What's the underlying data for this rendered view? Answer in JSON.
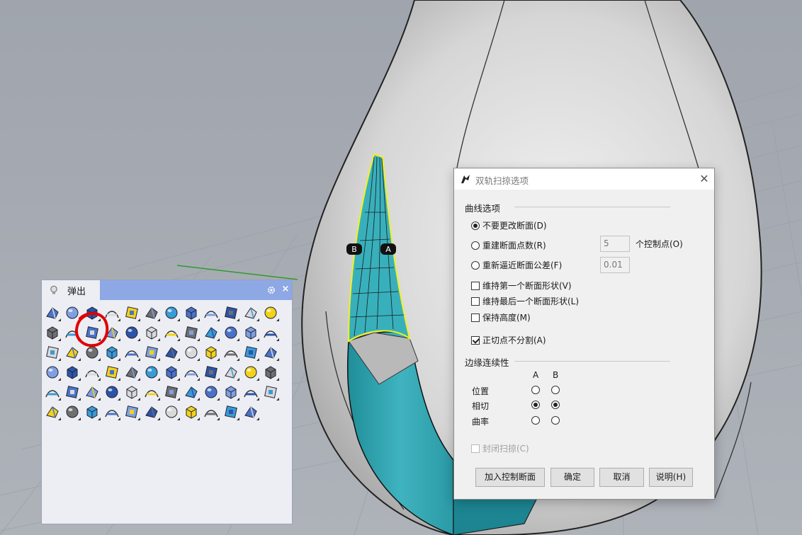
{
  "viewport": {
    "label_b": "B",
    "label_a": "A"
  },
  "popup": {
    "tab_label": "弹出",
    "close_glyph": "×",
    "tools": [
      "render-sphere",
      "curve-wave",
      "circle-arc",
      "curve-degree-2",
      "curve-arc-point",
      "line-dotted-degree",
      "circle-degree",
      "color-wheel",
      "box-shaded",
      "cone-yellow",
      "cube-yellow",
      "cloud-surface",
      "box-blue",
      "loft-box",
      "sweep-2-rail",
      "edge-surface",
      "surface-funnel",
      "fan-surface",
      "sweep-1-rail",
      "network-surface",
      "patch-surface",
      "extrude-cube",
      "twisted-surface",
      "planar-surface",
      "sphere-highlight",
      "bend-surface",
      "curve-degree-points",
      "trim-person",
      "bounding-box",
      "plane-normal",
      "offset-surface",
      "stair-surface",
      "blend-curl",
      "boolean-union",
      "boolean-difference",
      "boolean-split",
      "spheres-pair",
      "cube-solid",
      "box-solid",
      "lines-surface",
      "flat-panel",
      "sheet-fold",
      "numbered-sheet",
      "gear-puzzle",
      "lightning-break",
      "dotted-arc",
      "arrow-sweep",
      "dotted-arch",
      "branch-nodes",
      "ruler-check",
      "grid-squares",
      "dotted-circle",
      "black-square",
      "dotted-chain",
      "pipe-y",
      "book-surface",
      "capsule-dots",
      "mirror-surface",
      "vertical-dots",
      "blue-square",
      "ground-plane",
      "railing-points",
      "smooth-curve",
      "spiral",
      "circle-dots",
      "arrow-points",
      "yellow-plane",
      "yellow-box",
      "hammer-tool",
      "light-bulb",
      "save-disk"
    ]
  },
  "dialog": {
    "title": "双轨扫掠选项",
    "close_glyph": "✕",
    "curve_options_label": "曲线选项",
    "opt_no_change": "不要更改断面(D)",
    "opt_rebuild": "重建断面点数(R)",
    "rebuild_value": "5",
    "control_points_label": "个控制点(O)",
    "opt_refit": "重新逼近断面公差(F)",
    "refit_value": "0.01",
    "chk_first_shape": "维持第一个断面形状(V)",
    "chk_last_shape": "维持最后一个断面形状(L)",
    "chk_height": "保持高度(M)",
    "chk_no_split": "正切点不分割(A)",
    "edge_continuity_label": "边缘连续性",
    "col_a": "A",
    "col_b": "B",
    "row_position": "位置",
    "row_tangent": "相切",
    "row_curvature": "曲率",
    "chk_closed": "封闭扫掠(C)",
    "btn_add_section": "加入控制断面",
    "btn_ok": "确定",
    "btn_cancel": "取消",
    "btn_help": "说明(H)"
  }
}
